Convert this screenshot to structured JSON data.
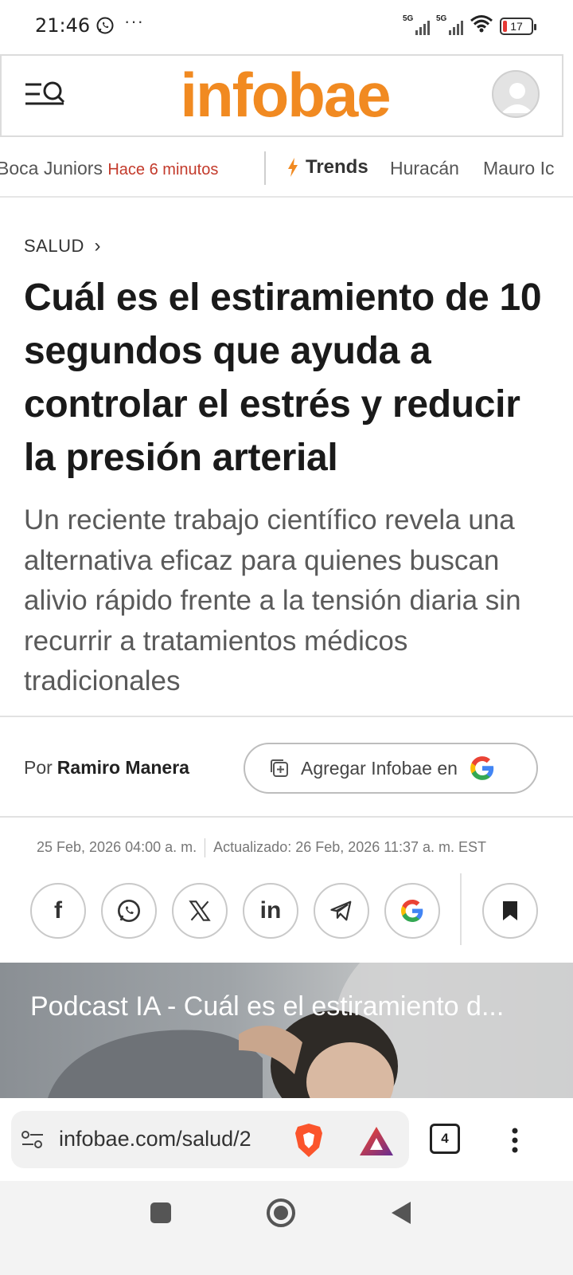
{
  "status_bar": {
    "time": "21:46",
    "dots": "···",
    "network_1": "5G",
    "network_2": "5G",
    "battery": "17"
  },
  "header": {
    "logo": "infobae"
  },
  "trends": {
    "prev_item": "Boca Juniors",
    "prev_time": "Hace 6 minutos",
    "label": "Trends",
    "items": [
      "Huracán",
      "Mauro Ic"
    ]
  },
  "article": {
    "section": "SALUD",
    "section_chevron": "›",
    "headline": "Cuál es el estiramiento de 10 segundos que ayuda a controlar el estrés y reducir la presión arterial",
    "subtitle": "Un reciente trabajo científico revela una alternativa eficaz para quienes buscan alivio rápido frente a la tensión diaria sin recurrir a tratamientos médicos tradicionales",
    "byline_prefix": "Por",
    "author": "Ramiro Manera",
    "google_button": "Agregar Infobae en",
    "published": "25 Feb, 2026 04:00 a. m.",
    "updated": "Actualizado: 26 Feb, 2026 11:37 a. m. EST",
    "media_title": "Podcast IA - Cuál es el estiramiento d..."
  },
  "share": {
    "facebook": "f",
    "linkedin": "in"
  },
  "browser": {
    "url": "infobae.com/salud/2",
    "tab_count": "4"
  },
  "colors": {
    "brand": "#f18a21",
    "live": "#c33a2b"
  }
}
